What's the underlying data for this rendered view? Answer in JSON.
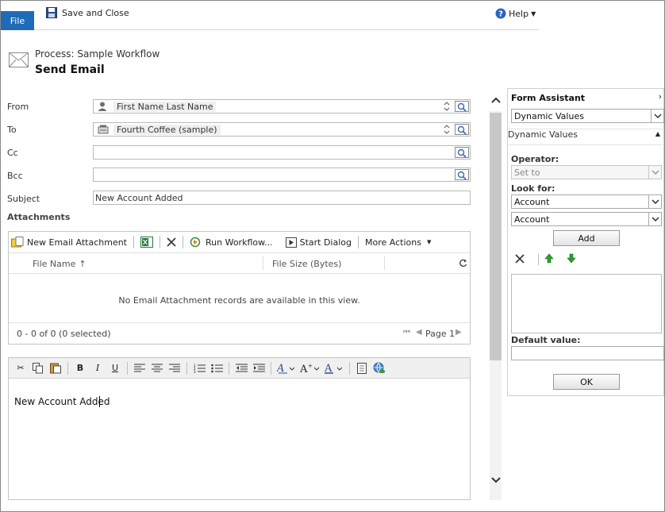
{
  "ribbon": {
    "file_label": "File",
    "save_close_label": "Save and Close",
    "help_label": "Help"
  },
  "header": {
    "process_title": "Process: Sample Workflow",
    "form_title": "Send Email"
  },
  "fields": {
    "from_label": "From",
    "from_value": "First Name Last Name",
    "to_label": "To",
    "to_value": "Fourth Coffee (sample)",
    "cc_label": "Cc",
    "bcc_label": "Bcc",
    "subject_label": "Subject",
    "subject_value": "New Account Added"
  },
  "attachments": {
    "section_title": "Attachments",
    "new_attachment_label": "New Email Attachment",
    "run_workflow_label": "Run Workflow...",
    "start_dialog_label": "Start Dialog",
    "more_actions_label": "More Actions",
    "col_file_name": "File Name",
    "col_file_size": "File Size (Bytes)",
    "empty_message": "No Email Attachment records are available in this view.",
    "record_count": "0 - 0 of 0 (0 selected)",
    "page_label": "Page 1"
  },
  "editor": {
    "bold": "B",
    "italic": "I",
    "underline": "U",
    "body_text": "New Account Added"
  },
  "form_assistant": {
    "title": "Form Assistant",
    "top_select": "Dynamic Values",
    "section_label": "Dynamic Values",
    "operator_label": "Operator:",
    "operator_value": "Set to",
    "look_for_label": "Look for:",
    "look_for_value_1": "Account",
    "look_for_value_2": "Account",
    "add_label": "Add",
    "default_value_label": "Default value:",
    "ok_label": "OK"
  },
  "colors": {
    "file_tab": "#1e6bb8",
    "green_arrow": "#2e9e2e",
    "excel_green": "#1f7a3a"
  }
}
